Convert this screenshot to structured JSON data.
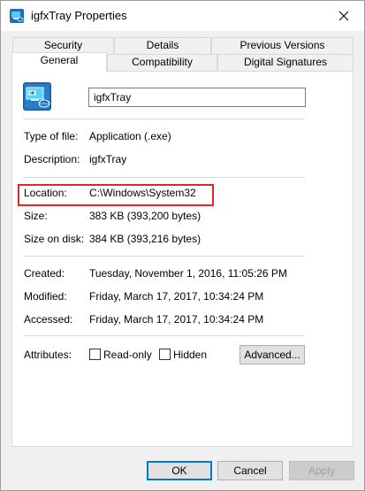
{
  "window": {
    "title": "igfxTray Properties"
  },
  "tabs": {
    "row1": [
      "Security",
      "Details",
      "Previous Versions"
    ],
    "row2": [
      "General",
      "Compatibility",
      "Digital Signatures"
    ],
    "selected": "General"
  },
  "general": {
    "file_name": "igfxTray",
    "type_label": "Type of file:",
    "type_value": "Application (.exe)",
    "description_label": "Description:",
    "description_value": "igfxTray",
    "location_label": "Location:",
    "location_value": "C:\\Windows\\System32",
    "size_label": "Size:",
    "size_value": "383 KB (393,200 bytes)",
    "size_on_disk_label": "Size on disk:",
    "size_on_disk_value": "384 KB (393,216 bytes)",
    "created_label": "Created:",
    "created_value": "Tuesday, November 1, 2016, 11:05:26 PM",
    "modified_label": "Modified:",
    "modified_value": "Friday, March 17, 2017, 10:34:24 PM",
    "accessed_label": "Accessed:",
    "accessed_value": "Friday, March 17, 2017, 10:34:24 PM",
    "attributes_label": "Attributes:",
    "readonly_label": "Read-only",
    "hidden_label": "Hidden",
    "advanced_label": "Advanced..."
  },
  "buttons": {
    "ok": "OK",
    "cancel": "Cancel",
    "apply": "Apply"
  },
  "colors": {
    "highlight": "#e3262e",
    "focus": "#0078d7"
  },
  "icons": {
    "title": "intel-graphics-icon",
    "app": "intel-graphics-icon",
    "close": "close-icon"
  }
}
